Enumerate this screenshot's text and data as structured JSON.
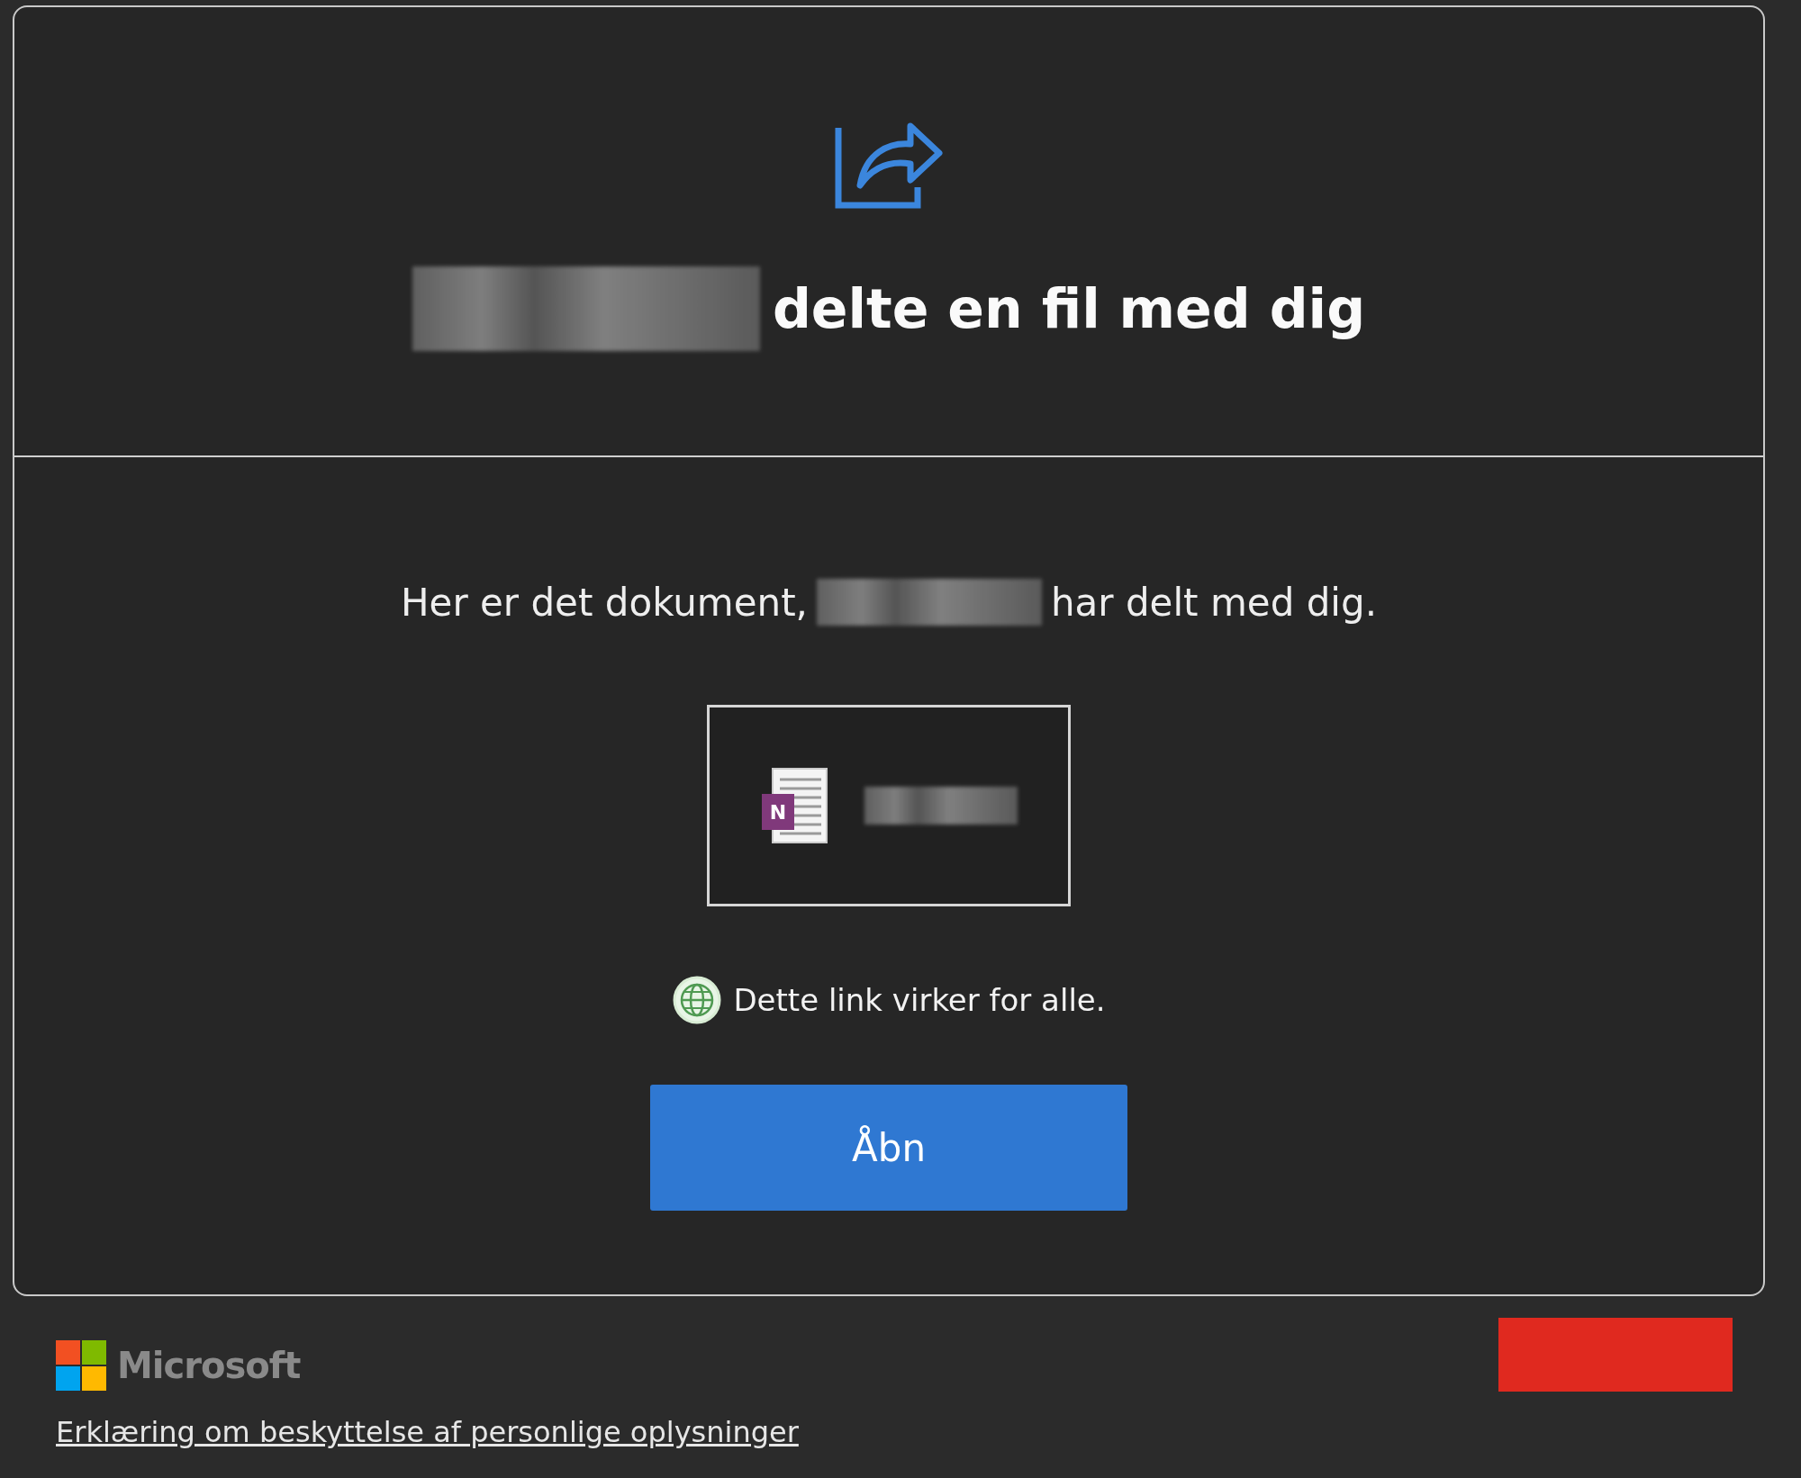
{
  "header": {
    "title_redacted": true,
    "title": "delte en fil med dig"
  },
  "message": {
    "before": "Her er det dokument,",
    "name_redacted": true,
    "after": "har delt med dig."
  },
  "file": {
    "kind": "onenote",
    "app_letter": "N",
    "name_redacted": true
  },
  "link_note": "Dette link virker for alle.",
  "open_button": "Åbn",
  "footer": {
    "brand": "Microsoft",
    "privacy_link": "Erklæring om beskyttelse af personlige oplysninger",
    "corner_redacted": true
  }
}
